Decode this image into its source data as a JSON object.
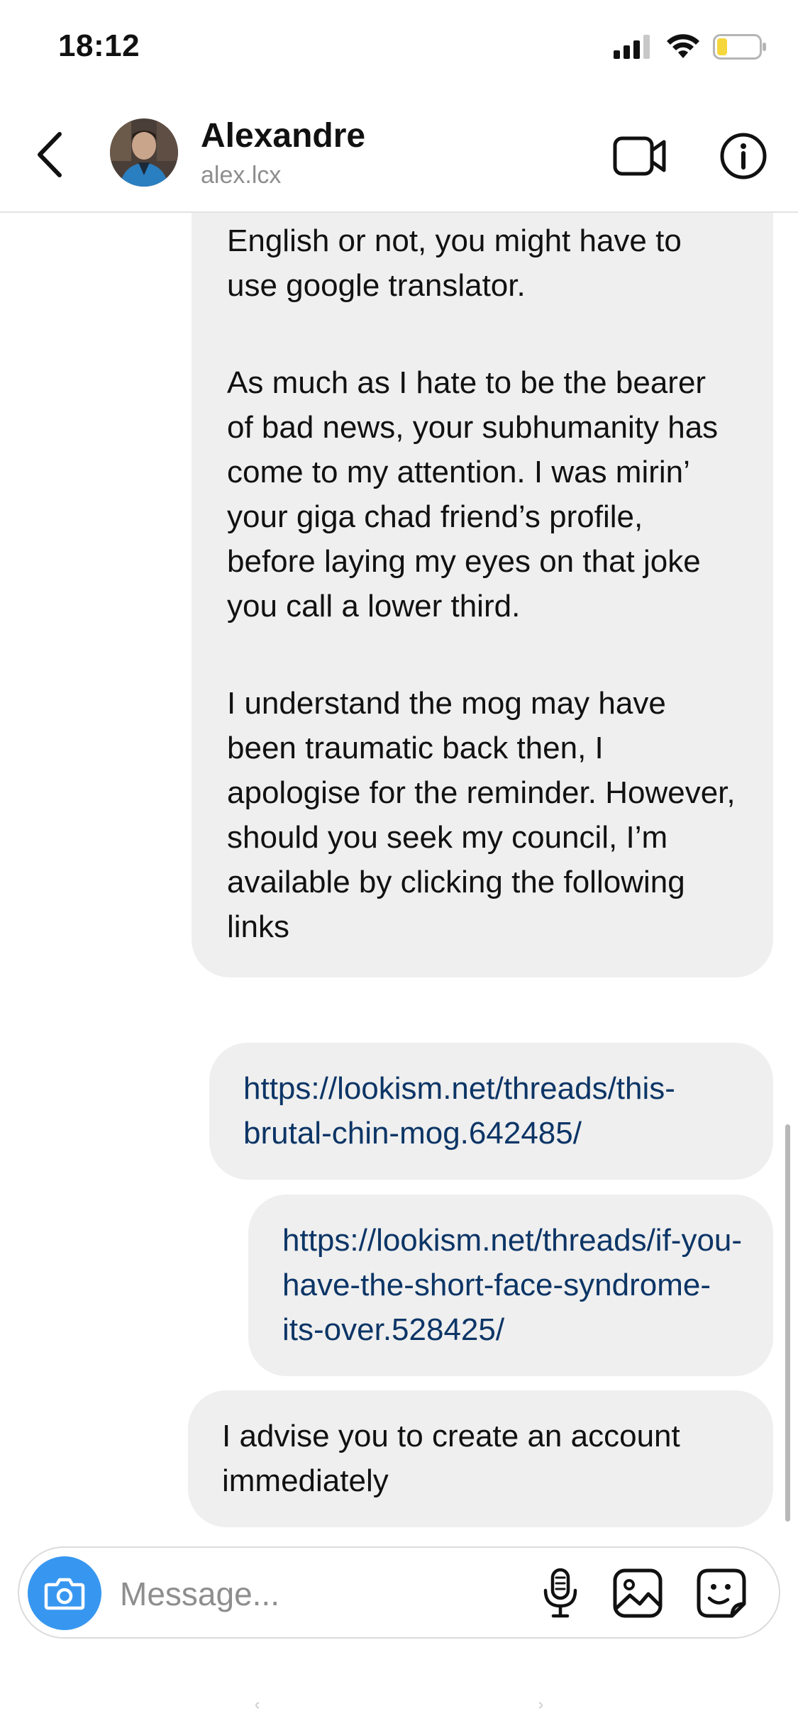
{
  "status_bar": {
    "time": "18:12"
  },
  "header": {
    "contact_name": "Alexandre",
    "contact_username": "alex.lcx",
    "back_icon": "chevron-left-icon",
    "video_icon": "video-camera-icon",
    "info_icon": "info-icon"
  },
  "thread": {
    "main_message": {
      "paragraphs": [
        "Hey man, not sure if you speak English or not, you might have to use google translator.",
        "As much as I hate to be the bearer of bad news, your subhumanity has come to my attention. I was mirin’ your giga chad friend’s profile, before laying my eyes on that joke you call a lower third.",
        "I understand the mog may have been traumatic back then, I apologise for the reminder. However, should you seek my council, I’m available by clicking the following links"
      ]
    },
    "links": [
      "https://lookism.net/threads/this-brutal-chin-mog.642485/",
      "https://lookism.net/threads/if-you-have-the-short-face-syndrome-its-over.528425/"
    ],
    "last_message": "I advise you to create an account immediately"
  },
  "composer": {
    "placeholder": "Message...",
    "camera_icon": "camera-icon",
    "mic_icon": "microphone-icon",
    "gallery_icon": "gallery-icon",
    "sticker_icon": "sticker-icon"
  },
  "colors": {
    "accent": "#3797f0",
    "bubble": "#efefef",
    "link": "#0c3566",
    "battery_low": "#f5d63d"
  }
}
